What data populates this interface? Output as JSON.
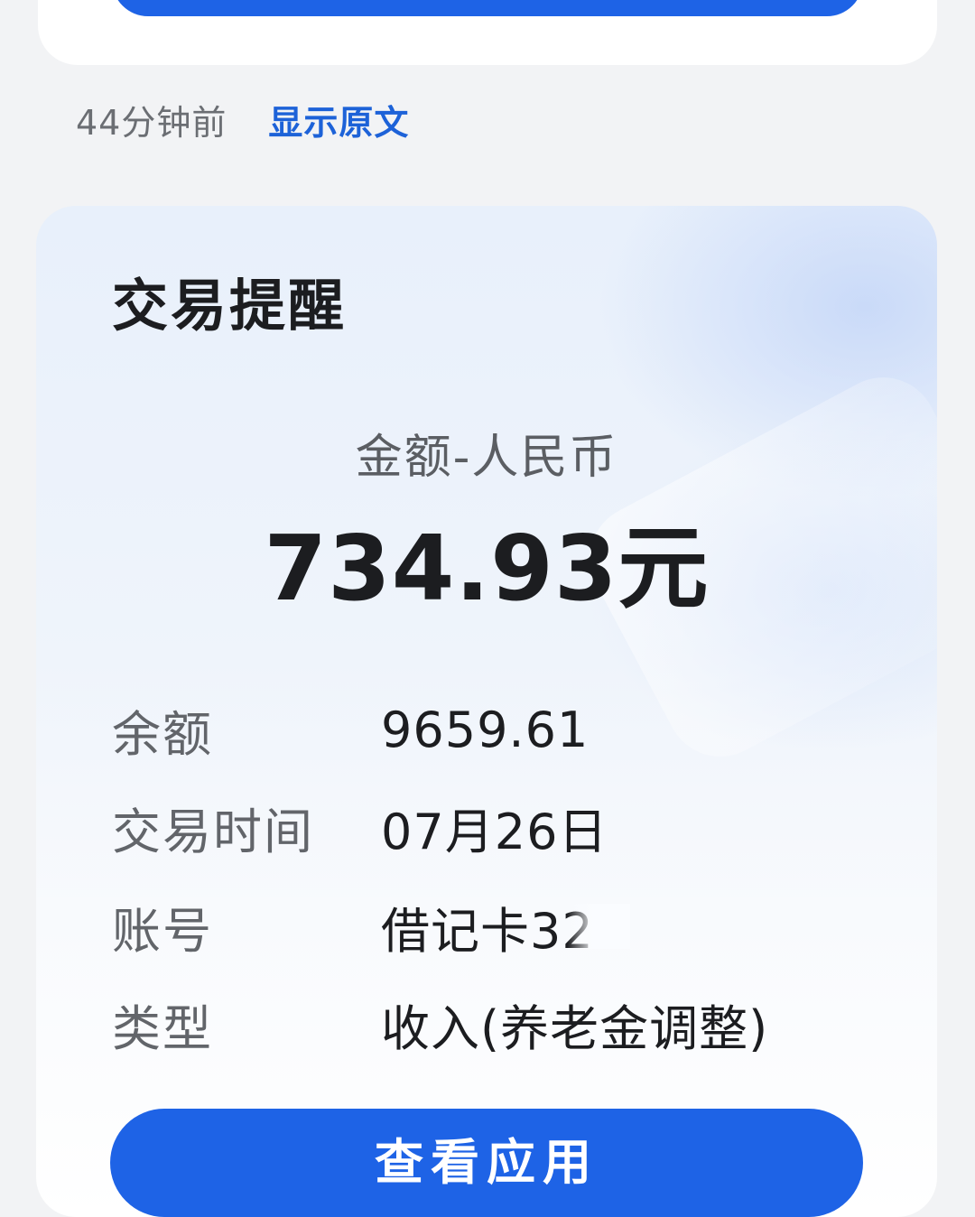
{
  "message": {
    "time_ago": "44分钟前",
    "show_original": "显示原文"
  },
  "card": {
    "title": "交易提醒",
    "amount_label": "金额-人民币",
    "amount_value": "734.93元",
    "details": [
      {
        "label": "余额",
        "value": "9659.61"
      },
      {
        "label": "交易时间",
        "value": "07月26日"
      },
      {
        "label": "账号",
        "value": "借记卡32"
      },
      {
        "label": "类型",
        "value": "收入(养老金调整)"
      }
    ],
    "button_label": "查看应用"
  },
  "colors": {
    "accent": "#1e63e6",
    "link": "#1d62d8",
    "background": "#f2f3f5"
  }
}
